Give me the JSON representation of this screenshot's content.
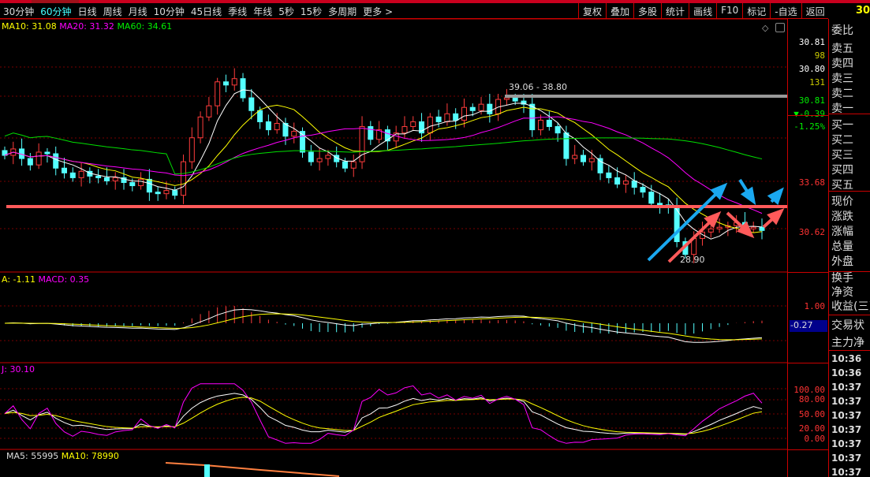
{
  "header": {
    "tabs": [
      "30分钟",
      "60分钟",
      "日线",
      "周线",
      "月线",
      "10分钟",
      "45日线",
      "季线",
      "年线",
      "5秒",
      "15秒",
      "多周期",
      "更多 >"
    ],
    "active_tab": 1,
    "tools": [
      "复权",
      "叠加",
      "多股",
      "统计",
      "画线",
      "F10",
      "标记",
      "-自选",
      "返回"
    ],
    "code": "30"
  },
  "main": {
    "legend": {
      "ma10": "MA10: 31.08",
      "ma20": "MA20: 31.32",
      "ma60": "MA60: 34.61"
    },
    "range_label": "39.06 - 38.80",
    "low_label": "28.90",
    "axis": {
      "a1": "33.68",
      "a2": "30.62"
    }
  },
  "quote": {
    "sell5_price": "30.81",
    "sell5_vol": "98",
    "sell4_price": "30.80",
    "sell4_vol": "131",
    "price": "30.81",
    "change": "▼-0.39",
    "pct": "-1.25%"
  },
  "macd": {
    "dif": "A: -1.11",
    "macd": "MACD: 0.35",
    "axis": "1.00",
    "current": "-0.27"
  },
  "kdj": {
    "j": "J: 30.10",
    "axis": [
      "100.00",
      "80.00",
      "50.00",
      "20.00",
      "0.00"
    ]
  },
  "volume": {
    "ma5": "MA5: 55995",
    "ma10": "MA10: 78990"
  },
  "panel": {
    "labels": [
      "委比",
      "卖五",
      "卖四",
      "卖三",
      "卖二",
      "卖一",
      "买一",
      "买二",
      "买三",
      "买四",
      "买五",
      "现价",
      "涨跌",
      "涨幅",
      "总量",
      "外盘",
      "换手",
      "净资",
      "收益(三)",
      "交易状",
      "主力净"
    ],
    "times": [
      "10:36",
      "10:36",
      "10:37",
      "10:37",
      "10:37",
      "10:37",
      "10:37",
      "10:37",
      "10:37"
    ]
  },
  "colors": {
    "up": "#ff3c3c",
    "down": "#54ffff",
    "ma10": "#ffff00",
    "ma20": "#ff00ff",
    "ma60": "#00e000",
    "support": "#ff5a5a",
    "blue_arrow": "#1aa8f0"
  },
  "chart_data": {
    "type": "candlestick",
    "closes": [
      35.4,
      35.8,
      35.2,
      34.8,
      35.6,
      35.5,
      34.6,
      34.3,
      34.0,
      34.4,
      34.1,
      34.0,
      33.8,
      34.0,
      33.7,
      33.5,
      33.9,
      33.1,
      33.0,
      33.2,
      32.9,
      35.0,
      36.5,
      37.8,
      38.5,
      40.0,
      39.8,
      40.2,
      39.0,
      38.2,
      37.5,
      37.0,
      37.4,
      36.6,
      36.9,
      35.6,
      35.0,
      35.2,
      35.4,
      35.0,
      34.6,
      35.0,
      37.2,
      36.4,
      37.0,
      36.3,
      36.8,
      37.2,
      37.5,
      36.8,
      37.8,
      37.5,
      38.0,
      37.6,
      38.4,
      38.2,
      38.6,
      38.0,
      38.9,
      39.0,
      38.8,
      38.6,
      37.0,
      37.6,
      37.2,
      36.8,
      35.2,
      35.4,
      35.0,
      35.2,
      34.3,
      34.0,
      33.6,
      33.8,
      33.4,
      33.1,
      32.4,
      32.3,
      32.2,
      30.0,
      29.2,
      30.2,
      30.6,
      30.8,
      30.9,
      31.0,
      31.2,
      30.8,
      30.9,
      30.7
    ],
    "price_range": [
      28.1,
      42.9
    ]
  }
}
